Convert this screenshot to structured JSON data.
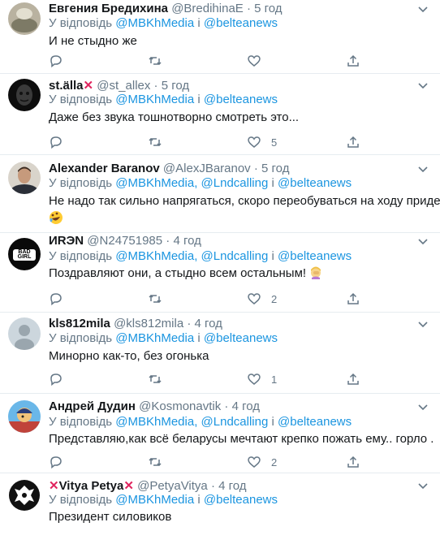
{
  "reply_prefix": "У відповідь",
  "conj": "і",
  "dot": "·",
  "tweets": [
    {
      "name": "Евгения Бредихина",
      "handle": "@BredihinaE",
      "time": "5 год",
      "mentions": [
        "@MBKhMedia",
        "@belteanews"
      ],
      "text": "И не стыдно же",
      "reply_count": "",
      "retweet_count": "",
      "like_count": ""
    },
    {
      "name": "st.älla",
      "name_mark": "✕",
      "handle": "@st_allex",
      "time": "5 год",
      "mentions": [
        "@MBKhMedia",
        "@belteanews"
      ],
      "text": "Даже без звука тошнотворно смотреть это...",
      "like_count": "5"
    },
    {
      "name": "Alexander Baranov",
      "handle": "@AlexJBaranov",
      "time": "5 год",
      "mentions": [
        "@MBKhMedia",
        "@Lndcalling",
        "@belteanews"
      ],
      "text": "Не надо так сильно напрягаться, скоро переобуваться на ходу придется.",
      "emoji": "rolling-on-floor-laughing"
    },
    {
      "name": "ИRЭN",
      "handle": "@N24751985",
      "time": "4 год",
      "mentions": [
        "@MBKhMedia",
        "@Lndcalling",
        "@belteanews"
      ],
      "text": "Поздравляют они, а стыдно всем остальным!",
      "emoji": "woman-facepalming",
      "like_count": "2"
    },
    {
      "name": "kls812mila",
      "handle": "@kls812mila",
      "time": "4 год",
      "mentions": [
        "@MBKhMedia",
        "@belteanews"
      ],
      "text": "Минорно как-то, без огонька",
      "like_count": "1"
    },
    {
      "name": "Андрей Дудин",
      "handle": "@Kosmonavtik",
      "time": "4 год",
      "mentions": [
        "@MBKhMedia",
        "@Lndcalling",
        "@belteanews"
      ],
      "text": "Представляю,как всё беларусы мечтают крепко пожать ему.. горло .",
      "like_count": "2"
    },
    {
      "name": "Vitya Petya",
      "name_mark": "✕",
      "handle": "@PetyaVitya",
      "time": "4 год",
      "mentions": [
        "@MBKhMedia",
        "@belteanews"
      ],
      "text": "Президент силовиков"
    }
  ],
  "avatar_logo_text": "BAD GIRL",
  "colors": {
    "link": "#1b95e0",
    "muted": "#657786",
    "mark": "#e0245e"
  }
}
